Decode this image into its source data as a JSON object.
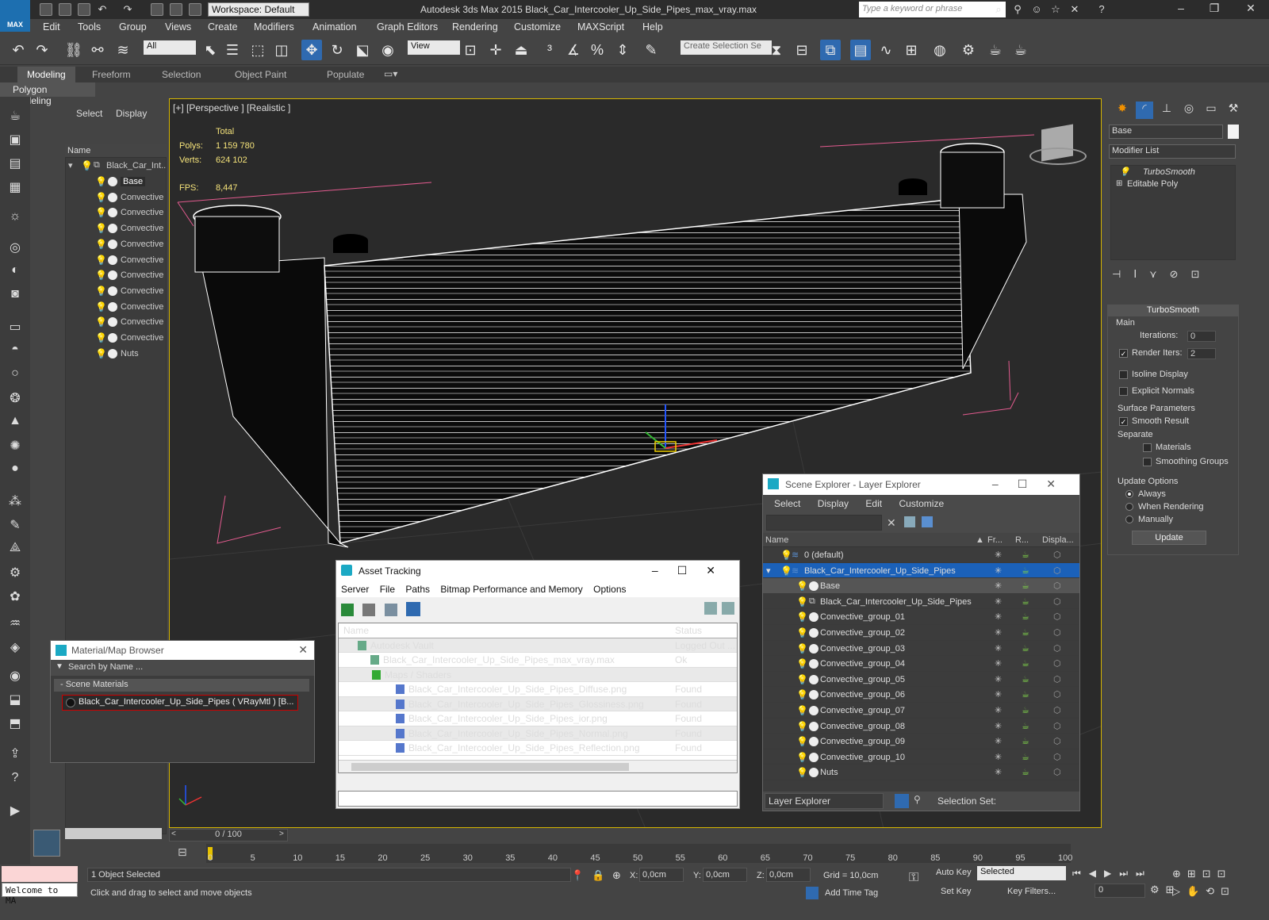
{
  "app": {
    "title": "Autodesk 3ds Max  2015    Black_Car_Intercooler_Up_Side_Pipes_max_vray.max",
    "logo": "MAX",
    "workspace": "Workspace: Default",
    "search_placeholder": "Type a keyword or phrase"
  },
  "menu": [
    "Edit",
    "Tools",
    "Group",
    "Views",
    "Create",
    "Modifiers",
    "Animation",
    "Graph Editors",
    "Rendering",
    "Customize",
    "MAXScript",
    "Help"
  ],
  "toolbar": {
    "selection_filter": "All",
    "ref_coord": "View",
    "create_selection_set": "Create Selection Se"
  },
  "ribbon": {
    "tabs": [
      "Modeling",
      "Freeform",
      "Selection",
      "Object Paint",
      "Populate"
    ],
    "active": "Modeling",
    "sub_label": "Polygon Modeling"
  },
  "left_explorer": {
    "select": "Select",
    "display": "Display",
    "header": "Name",
    "root": "Black_Car_Int...",
    "items": [
      "Base",
      "Convective",
      "Convective",
      "Convective",
      "Convective",
      "Convective",
      "Convective",
      "Convective",
      "Convective",
      "Convective",
      "Convective",
      "Nuts"
    ]
  },
  "viewport": {
    "label": "[+] [Perspective ] [Realistic ]",
    "stats_header": "Total",
    "polys_label": "Polys:",
    "polys": "1 159 780",
    "verts_label": "Verts:",
    "verts": "624 102",
    "fps_label": "FPS:",
    "fps": "8,447"
  },
  "asset_tracking": {
    "title": "Asset Tracking",
    "menu": [
      "Server",
      "File",
      "Paths",
      "Bitmap Performance and Memory",
      "Options"
    ],
    "col_name": "Name",
    "col_status": "Status",
    "rows": [
      {
        "name": "Autodesk Vault",
        "status": "Logged Out ..."
      },
      {
        "name": "Black_Car_Intercooler_Up_Side_Pipes_max_vray.max",
        "status": "Ok"
      },
      {
        "name": "Maps / Shaders",
        "status": ""
      },
      {
        "name": "Black_Car_Intercooler_Up_Side_Pipes_Diffuse.png",
        "status": "Found"
      },
      {
        "name": "Black_Car_Intercooler_Up_Side_Pipes_Glossiness.png",
        "status": "Found"
      },
      {
        "name": "Black_Car_Intercooler_Up_Side_Pipes_ior.png",
        "status": "Found"
      },
      {
        "name": "Black_Car_Intercooler_Up_Side_Pipes_Normal.png",
        "status": "Found"
      },
      {
        "name": "Black_Car_Intercooler_Up_Side_Pipes_Reflection.png",
        "status": "Found"
      }
    ]
  },
  "material_browser": {
    "title": "Material/Map Browser",
    "search_placeholder": "Search by Name ...",
    "section": "- Scene Materials",
    "item": "Black_Car_Intercooler_Up_Side_Pipes  ( VRayMtl ) [B..."
  },
  "layer_explorer": {
    "title": "Scene Explorer - Layer Explorer",
    "menu": [
      "Select",
      "Display",
      "Edit",
      "Customize"
    ],
    "col_name": "Name",
    "col_freeze": "Fr...",
    "col_render": "R...",
    "col_display": "Displa...",
    "rows": [
      {
        "name": "0 (default)",
        "type": "layer"
      },
      {
        "name": "Black_Car_Intercooler_Up_Side_Pipes",
        "type": "layer"
      },
      {
        "name": "Base",
        "type": "object"
      },
      {
        "name": "Black_Car_Intercooler_Up_Side_Pipes",
        "type": "group"
      },
      {
        "name": "Convective_group_01",
        "type": "object"
      },
      {
        "name": "Convective_group_02",
        "type": "object"
      },
      {
        "name": "Convective_group_03",
        "type": "object"
      },
      {
        "name": "Convective_group_04",
        "type": "object"
      },
      {
        "name": "Convective_group_05",
        "type": "object"
      },
      {
        "name": "Convective_group_06",
        "type": "object"
      },
      {
        "name": "Convective_group_07",
        "type": "object"
      },
      {
        "name": "Convective_group_08",
        "type": "object"
      },
      {
        "name": "Convective_group_09",
        "type": "object"
      },
      {
        "name": "Convective_group_10",
        "type": "object"
      },
      {
        "name": "Nuts",
        "type": "object"
      }
    ],
    "footer_dropdown": "Layer Explorer",
    "footer_selection_set": "Selection Set:"
  },
  "command_panel": {
    "object_name": "Base",
    "modifier_list": "Modifier List",
    "stack": [
      "TurboSmooth",
      "Editable Poly"
    ],
    "rollout_title": "TurboSmooth",
    "main": "Main",
    "iterations_label": "Iterations:",
    "iterations": "0",
    "render_iters_label": "Render Iters:",
    "render_iters": "2",
    "isoline": "Isoline Display",
    "explicit_normals": "Explicit Normals",
    "surface_params": "Surface Parameters",
    "smooth_result": "Smooth Result",
    "separate": "Separate",
    "materials": "Materials",
    "smoothing_groups": "Smoothing Groups",
    "update_options": "Update Options",
    "always": "Always",
    "when_rendering": "When Rendering",
    "manually": "Manually",
    "update_btn": "Update"
  },
  "timeline": {
    "slider": "0 / 100",
    "ticks": [
      "0",
      "5",
      "10",
      "15",
      "20",
      "25",
      "30",
      "35",
      "40",
      "45",
      "50",
      "55",
      "60",
      "65",
      "70",
      "75",
      "80",
      "85",
      "90",
      "95",
      "100"
    ]
  },
  "status": {
    "listener": "Welcome to MA",
    "selection": "1 Object Selected",
    "prompt": "Click and drag to select and move objects",
    "x_label": "X:",
    "x": "0,0cm",
    "y_label": "Y:",
    "y": "0,0cm",
    "z_label": "Z:",
    "z": "0,0cm",
    "grid": "Grid = 10,0cm",
    "auto_key": "Auto Key",
    "selected": "Selected",
    "set_key": "Set Key",
    "key_filters": "Key Filters...",
    "add_time_tag": "Add Time Tag",
    "frame": "0"
  }
}
